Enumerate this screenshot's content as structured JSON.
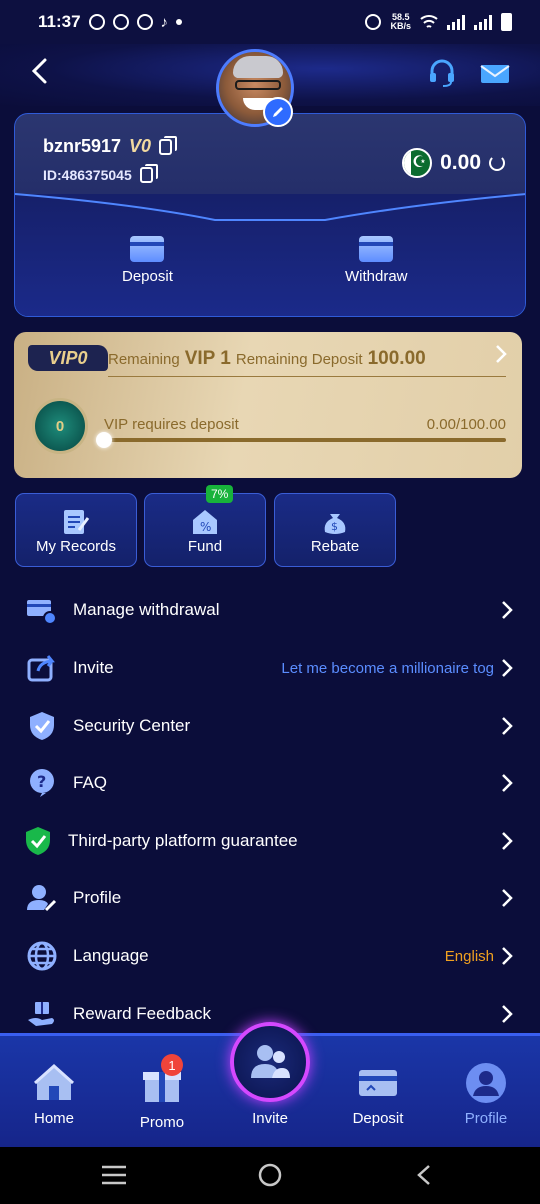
{
  "status_bar": {
    "time": "11:37",
    "net_speed_top": "58.5",
    "net_speed_bottom": "KB/s"
  },
  "user": {
    "username": "bznr5917",
    "vip_mark": "V0",
    "id_label": "ID:486375045",
    "balance": "0.00"
  },
  "card_actions": {
    "deposit": "Deposit",
    "withdraw": "Withdraw"
  },
  "vip": {
    "tag": "VIP0",
    "remaining_label": "Remaining",
    "next_level": "VIP 1",
    "remaining_deposit_label": "Remaining Deposit",
    "remaining_deposit": "100.00",
    "medal_level": "0",
    "requirement_label": "VIP requires deposit",
    "progress_text": "0.00/100.00",
    "progress_fraction": 0
  },
  "quick": {
    "records": "My Records",
    "fund": "Fund",
    "fund_badge": "7%",
    "rebate": "Rebate"
  },
  "menu": [
    {
      "label": "Manage withdrawal",
      "right": ""
    },
    {
      "label": "Invite",
      "right": "Let me become a millionaire tog"
    },
    {
      "label": "Security Center",
      "right": ""
    },
    {
      "label": "FAQ",
      "right": ""
    },
    {
      "label": "Third-party platform guarantee",
      "right": ""
    },
    {
      "label": "Profile",
      "right": ""
    },
    {
      "label": "Language",
      "right": "English"
    },
    {
      "label": "Reward Feedback",
      "right": ""
    }
  ],
  "bottom_nav": {
    "home": "Home",
    "promo": "Promo",
    "promo_badge": "1",
    "invite": "Invite",
    "deposit": "Deposit",
    "profile": "Profile"
  },
  "colors": {
    "accent": "#2f6bff",
    "active_tab": "#8fb0ff",
    "language_value": "#f0a020",
    "gold": "#8a6a2c"
  }
}
